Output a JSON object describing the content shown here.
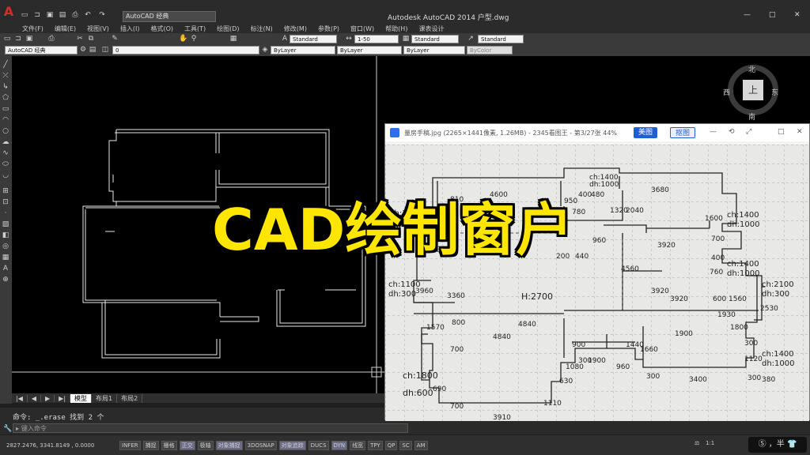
{
  "window": {
    "title": "Autodesk AutoCAD 2014    户型.dwg",
    "workspace": "AutoCAD 经典",
    "controls": [
      "—",
      "□",
      "✕"
    ]
  },
  "menu": [
    "文件(F)",
    "编辑(E)",
    "视图(V)",
    "插入(I)",
    "格式(O)",
    "工具(T)",
    "绘图(D)",
    "标注(N)",
    "修改(M)",
    "参数(P)",
    "窗口(W)",
    "帮助(H)",
    "课表设计"
  ],
  "styles": {
    "text_style": "Standard",
    "dim_scale": "1-50",
    "table_style": "Standard",
    "multileader_style": "Standard"
  },
  "layers": {
    "workspace": "AutoCAD 经典",
    "current_layer": "0",
    "color": "ByLayer",
    "linetype": "ByLayer",
    "lineweight": "ByLayer",
    "plotstyle": "ByColor"
  },
  "layout_tabs": [
    "模型",
    "布局1",
    "布局2"
  ],
  "command": {
    "history": "命令: _.erase 找到 2 个",
    "placeholder": "键入命令"
  },
  "status": {
    "coords": "2827.2476,  3341.8149 , 0.0000",
    "toggles": [
      "INFER",
      "捕捉",
      "栅格",
      "正交",
      "极轴",
      "对象捕捉",
      "3DOSNAP",
      "对象追踪",
      "DUCS",
      "DYN",
      "线宽",
      "TPY",
      "QP",
      "SC",
      "AM"
    ],
    "scale": "1:1"
  },
  "viewcube": {
    "north": "北",
    "south": "南",
    "west": "西",
    "east": "东",
    "face": "上"
  },
  "viewer": {
    "title": "量房手稿.jpg  (2265×1441像素, 1.26MB) - 2345看图王 - 第3/27张 44%",
    "btn_beautify": "美图",
    "btn_cutout": "抠图",
    "controls": [
      "—",
      "⟲",
      "⤢",
      "□",
      "✕"
    ]
  },
  "sketch_labels": [
    "ch:1400",
    "dh:1000",
    "3680",
    "4600",
    "810",
    "950",
    "400",
    "480",
    "1320",
    "2040",
    "780",
    "ch:1800",
    "dh:600",
    "1600",
    "ch:1400",
    "dh:1000",
    "700",
    "960",
    "3920",
    "200",
    "440",
    "400",
    "ch:1400",
    "dh:1000",
    "760",
    "4560",
    "ch:2100",
    "dh:300",
    "ch:1100",
    "dh:300",
    "3960",
    "3360",
    "H:2700",
    "3920",
    "3920",
    "600",
    "1560",
    "2530",
    "800",
    "1930",
    "1800",
    "4840",
    "1570",
    "4840",
    "1900",
    "700",
    "900",
    "1440",
    "1660",
    "300",
    "ch:1400",
    "dh:1000",
    "1120",
    "300",
    "ch:1800",
    "dh:600",
    "1080",
    "300",
    "1900",
    "960",
    "300",
    "3400",
    "690",
    "630",
    "1110",
    "700",
    "3910",
    "380"
  ],
  "overlay_title": "CAD绘制窗户"
}
